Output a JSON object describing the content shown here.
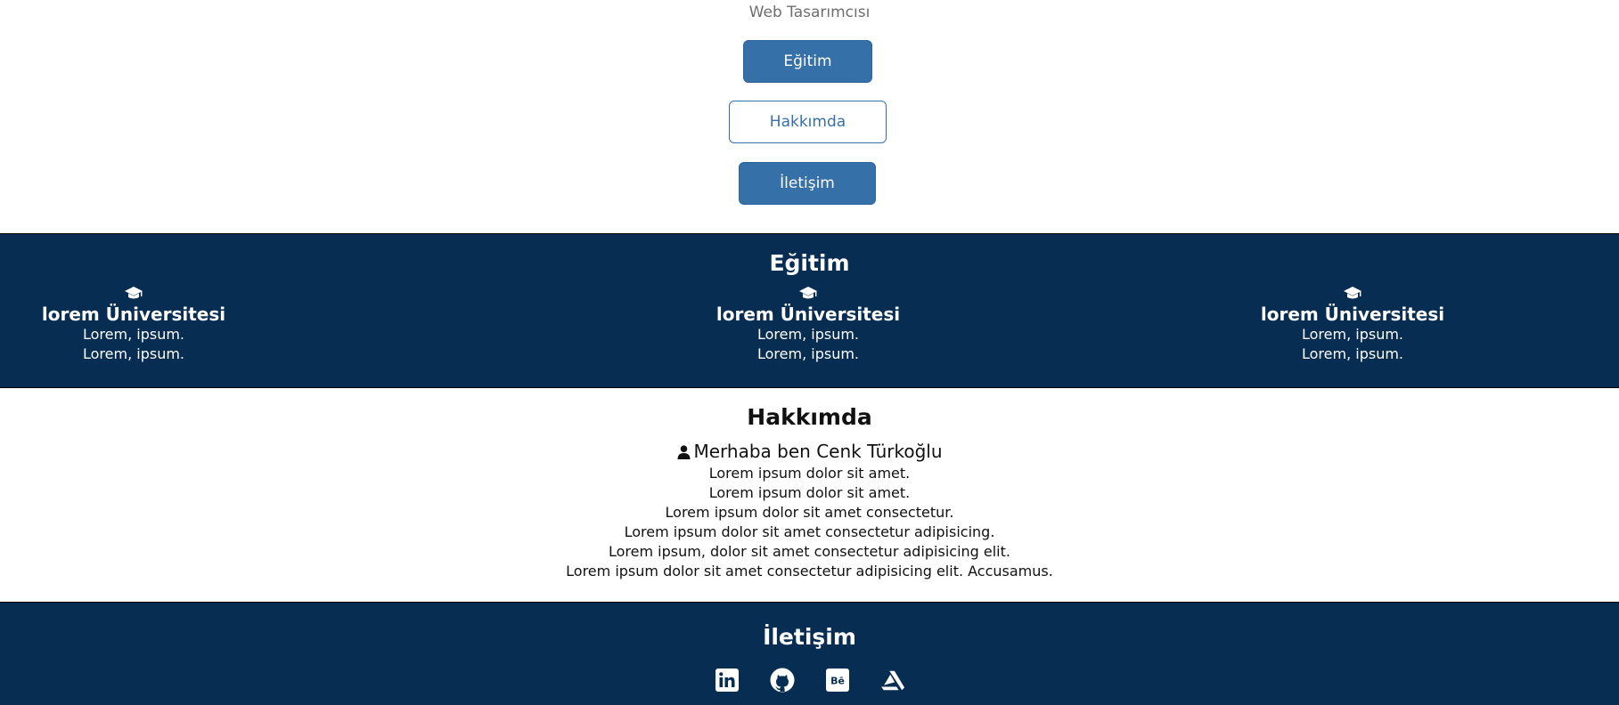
{
  "header": {
    "subtitle": "Web Tasarımcısı",
    "nav": {
      "egitim": "Eğitim",
      "hakkimda": "Hakkımda",
      "iletisim": "İletişim"
    }
  },
  "education": {
    "title": "Eğitim",
    "items": [
      {
        "icon": "graduation-cap-icon",
        "name": "lorem Üniversitesi",
        "line1": "Lorem, ipsum.",
        "line2": "Lorem, ipsum."
      },
      {
        "icon": "graduation-cap-icon",
        "name": "lorem Üniversitesi",
        "line1": "Lorem, ipsum.",
        "line2": "Lorem, ipsum."
      },
      {
        "icon": "graduation-cap-icon",
        "name": "lorem Üniversitesi",
        "line1": "Lorem, ipsum.",
        "line2": "Lorem, ipsum."
      }
    ]
  },
  "about": {
    "title": "Hakkımda",
    "greeting_icon": "user-icon",
    "greeting": "Merhaba ben Cenk Türkoğlu",
    "lines": [
      "Lorem ipsum dolor sit amet.",
      "Lorem ipsum dolor sit amet.",
      "Lorem ipsum dolor sit amet consectetur.",
      "Lorem ipsum dolor sit amet consectetur adipisicing.",
      "Lorem ipsum, dolor sit amet consectetur adipisicing elit.",
      "Lorem ipsum dolor sit amet consectetur adipisicing elit. Accusamus."
    ]
  },
  "contact": {
    "title": "İletişim",
    "socials": [
      "linkedin-icon",
      "github-icon",
      "behance-icon",
      "artstation-icon"
    ]
  },
  "colors": {
    "primary": "#3570a8",
    "dark_navy": "#082d52",
    "subtitle_gray": "#6e6e6e"
  }
}
